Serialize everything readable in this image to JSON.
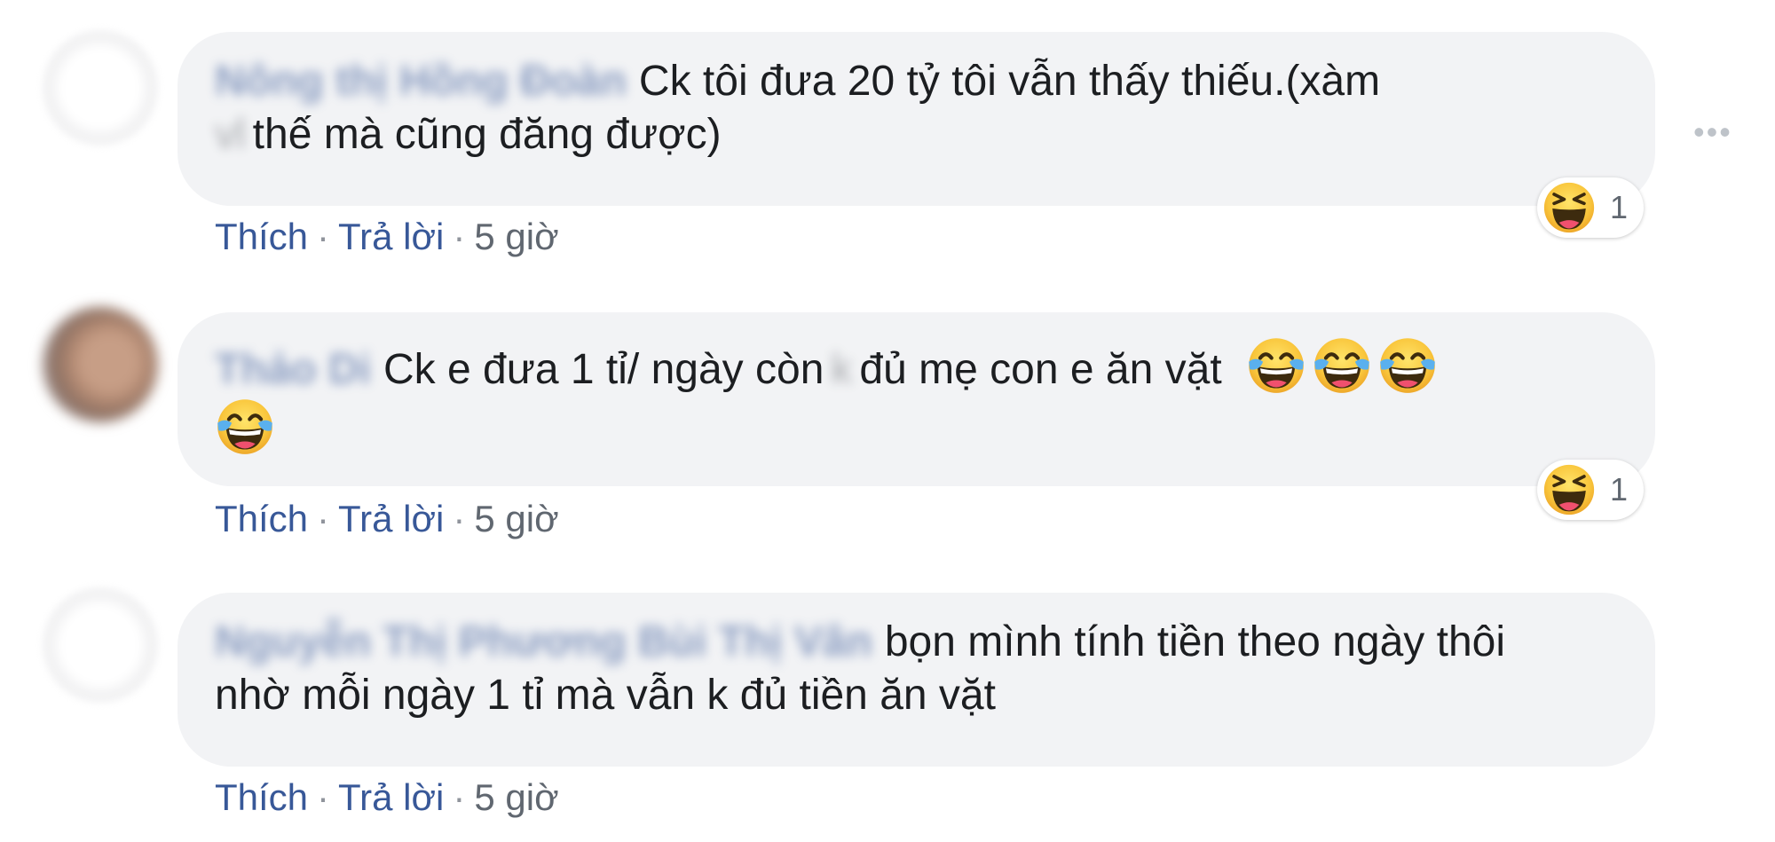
{
  "comments": [
    {
      "author": "Nông thị Hồng Đoàn",
      "text_part1": "Ck tôi đưa 20 tỷ tôi vẫn thấy thiếu.(xàm",
      "censored": "vl",
      "text_part2": "thế mà cũng đăng được)",
      "actions": {
        "like": "Thích",
        "reply": "Trả lời",
        "time": "5 giờ"
      },
      "reaction": {
        "icon": "haha-reaction-icon",
        "count": "1"
      }
    },
    {
      "author": "Thảo Di",
      "text_part1": "Ck e đưa 1 tỉ/ ngày còn",
      "censored": "k",
      "text_part2": "đủ mẹ con e ăn vặt",
      "emojis": [
        "laughing-tears-emoji",
        "laughing-tears-emoji",
        "laughing-tears-emoji",
        "laughing-tears-emoji"
      ],
      "actions": {
        "like": "Thích",
        "reply": "Trả lời",
        "time": "5 giờ"
      },
      "reaction": {
        "icon": "haha-reaction-icon",
        "count": "1"
      }
    },
    {
      "author": "Nguyễn Thị Phương Bùi Thị Vân",
      "text": "bọn mình tính tiền theo ngày thôi nhờ mỗi ngày 1 tỉ mà vẫn k đủ tiền ăn vặt",
      "actions": {
        "like": "Thích",
        "reply": "Trả lời",
        "time": "5 giờ"
      }
    }
  ],
  "separator": "·",
  "more_icon": "•••",
  "colors": {
    "bubble": "#f2f3f5",
    "link": "#385898",
    "text": "#1c1e21",
    "meta": "#606770"
  }
}
